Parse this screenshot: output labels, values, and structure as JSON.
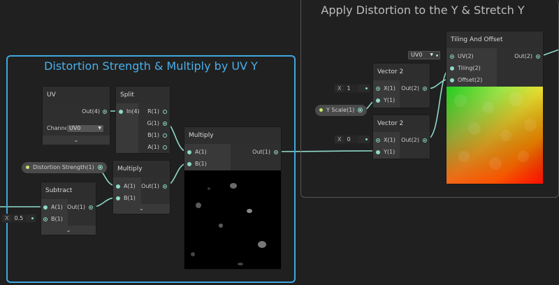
{
  "groups": {
    "distortion": {
      "title": "Distortion Strength & Multiply by UV Y"
    },
    "apply": {
      "title": "Apply Distortion to the Y & Stretch Y"
    }
  },
  "nodes": {
    "uv": {
      "title": "UV",
      "out": "Out(4)",
      "channel_label": "Channe",
      "channel_value": "UV0",
      "collapse": "⌄"
    },
    "split": {
      "title": "Split",
      "in": "In(4)",
      "outs": [
        "R(1)",
        "G(1)",
        "B(1)",
        "A(1)"
      ]
    },
    "multiply_top": {
      "title": "Multiply",
      "a": "A(1)",
      "b": "B(1)",
      "out": "Out(1)"
    },
    "multiply_small": {
      "title": "Multiply",
      "a": "A(1)",
      "b": "B(1)",
      "out": "Out(1)",
      "collapse": "⌄"
    },
    "subtract": {
      "title": "Subtract",
      "a": "A(1)",
      "b": "B(1)",
      "out": "Out(1)",
      "collapse": "⌄"
    },
    "vector2_top": {
      "title": "Vector 2",
      "x": "X(1)",
      "y": "Y(1)",
      "out": "Out(2)"
    },
    "vector2_bottom": {
      "title": "Vector 2",
      "x": "X(1)",
      "y": "Y(1)",
      "out": "Out(2)"
    },
    "tiling": {
      "title": "Tiling And Offset",
      "uv": "UV(2)",
      "tiling": "Tiling(2)",
      "offset": "Offset(2)",
      "out": "Out(2)"
    }
  },
  "properties": {
    "distortion_strength": "Distortion Strength(1)",
    "y_scale": "Y Scale(1)"
  },
  "fields": {
    "subtract_b": {
      "label": "X",
      "value": "0.5"
    },
    "vec_top_x": {
      "label": "X",
      "value": "1"
    },
    "vec_bottom_x": {
      "label": "X",
      "value": "0"
    },
    "tiling_uv": {
      "value": "UV0"
    }
  },
  "colors": {
    "selection": "#3fa8e0",
    "port": "#8fd9c8",
    "wire": "#8fd9c8",
    "property_dot": "#c7e870"
  }
}
